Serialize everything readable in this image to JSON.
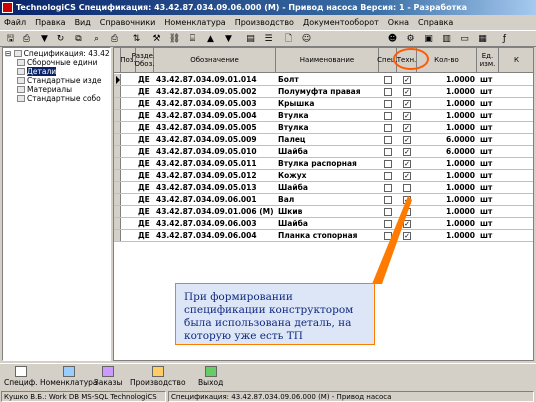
{
  "window": {
    "title": "TechnologiCS Спецификация: 43.42.87.034.09.06.000 (М) - Привод насоса Версия: 1 - Разработка"
  },
  "menu": [
    "Файл",
    "Правка",
    "Вид",
    "Справочники",
    "Номенклатура",
    "Производство",
    "Документооборот",
    "Окна",
    "Справка"
  ],
  "tree": {
    "root": "Спецификация: 43.42",
    "items": [
      "Сборочные едини",
      "Детали",
      "Стандартные изде",
      "Материалы",
      "Стандартные собо"
    ],
    "selected_index": 1
  },
  "grid": {
    "headers": {
      "pos": "Поз.",
      "section": "Раздел",
      "section_abbr": "Обоз.",
      "designation": "Обозначение",
      "name": "Наименование",
      "spec": "Спец.",
      "tech": "Техн.",
      "qty": "Кол-во",
      "unit": "Ед. изм.",
      "extra": "К"
    },
    "rows": [
      {
        "section": "ДЕ",
        "designation": "43.42.87.034.09.01.014",
        "name": "Болт",
        "spec": false,
        "tech": true,
        "qty": "1.0000",
        "unit": "шт"
      },
      {
        "section": "ДЕ",
        "designation": "43.42.87.034.09.05.002",
        "name": "Полумуфта правая",
        "spec": false,
        "tech": true,
        "qty": "1.0000",
        "unit": "шт"
      },
      {
        "section": "ДЕ",
        "designation": "43.42.87.034.09.05.003",
        "name": "Крышка",
        "spec": false,
        "tech": true,
        "qty": "1.0000",
        "unit": "шт"
      },
      {
        "section": "ДЕ",
        "designation": "43.42.87.034.09.05.004",
        "name": "Втулка",
        "spec": false,
        "tech": true,
        "qty": "1.0000",
        "unit": "шт"
      },
      {
        "section": "ДЕ",
        "designation": "43.42.87.034.09.05.005",
        "name": "Втулка",
        "spec": false,
        "tech": true,
        "qty": "1.0000",
        "unit": "шт"
      },
      {
        "section": "ДЕ",
        "designation": "43.42.87.034.09.05.009",
        "name": "Палец",
        "spec": false,
        "tech": true,
        "qty": "6.0000",
        "unit": "шт"
      },
      {
        "section": "ДЕ",
        "designation": "43.42.87.034.09.05.010",
        "name": "Шайба",
        "spec": false,
        "tech": true,
        "qty": "6.0000",
        "unit": "шт"
      },
      {
        "section": "ДЕ",
        "designation": "43.42.87.034.09.05.011",
        "name": "Втулка распорная",
        "spec": false,
        "tech": true,
        "qty": "1.0000",
        "unit": "шт"
      },
      {
        "section": "ДЕ",
        "designation": "43.42.87.034.09.05.012",
        "name": "Кожух",
        "spec": false,
        "tech": true,
        "qty": "1.0000",
        "unit": "шт"
      },
      {
        "section": "ДЕ",
        "designation": "43.42.87.034.09.05.013",
        "name": "Шайба",
        "spec": false,
        "tech": false,
        "qty": "1.0000",
        "unit": "шт"
      },
      {
        "section": "ДЕ",
        "designation": "43.42.87.034.09.06.001",
        "name": "Вал",
        "spec": false,
        "tech": true,
        "qty": "1.0000",
        "unit": "шт"
      },
      {
        "section": "ДЕ",
        "designation": "43.42.87.034.09.01.006 (М)",
        "name": "Шкив",
        "spec": false,
        "tech": true,
        "qty": "1.0000",
        "unit": "шт"
      },
      {
        "section": "ДЕ",
        "designation": "43.42.87.034.09.06.003",
        "name": "Шайба",
        "spec": false,
        "tech": true,
        "qty": "1.0000",
        "unit": "шт"
      },
      {
        "section": "ДЕ",
        "designation": "43.42.87.034.09.06.004",
        "name": "Планка стопорная",
        "spec": false,
        "tech": true,
        "qty": "1.0000",
        "unit": "шт"
      }
    ]
  },
  "callout": {
    "text": "При формировании спецификации конструктором была использована деталь, на которую уже есть ТП"
  },
  "bottom_tabs": [
    "Специф.",
    "Номенклатура",
    "Заказы",
    "Производство",
    "Выход"
  ],
  "status": {
    "user": "Кушко В.Б.: Work DB MS-SQL TechnologiCS",
    "doc": "Спецификация: 43.42.87.034.09.06.000 (М) - Привод насоса"
  },
  "colors": {
    "title_start": "#0a246a",
    "title_end": "#a6caf0",
    "highlight": "#ff5a00",
    "callout_bg": "#dde6f6",
    "callout_text": "#102a80"
  }
}
